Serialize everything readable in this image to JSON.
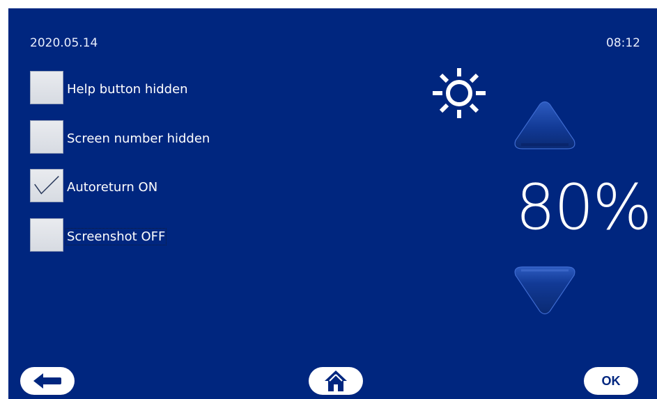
{
  "header": {
    "date": "2020.05.14",
    "time": "08:12"
  },
  "options": [
    {
      "label": "Help button hidden",
      "checked": false
    },
    {
      "label": "Screen number hidden",
      "checked": false
    },
    {
      "label": "Autoreturn ON",
      "checked": true
    },
    {
      "label": "Screenshot OFF",
      "checked": false,
      "focused": true
    }
  ],
  "brightness": {
    "value": "80%",
    "icon": "sun-icon"
  },
  "footer": {
    "back_icon": "arrow-left-icon",
    "home_icon": "home-icon",
    "ok_label": "OK"
  },
  "colors": {
    "background": "#00267f",
    "text": "#ffffff",
    "checkbox": "#dfe3ea"
  }
}
